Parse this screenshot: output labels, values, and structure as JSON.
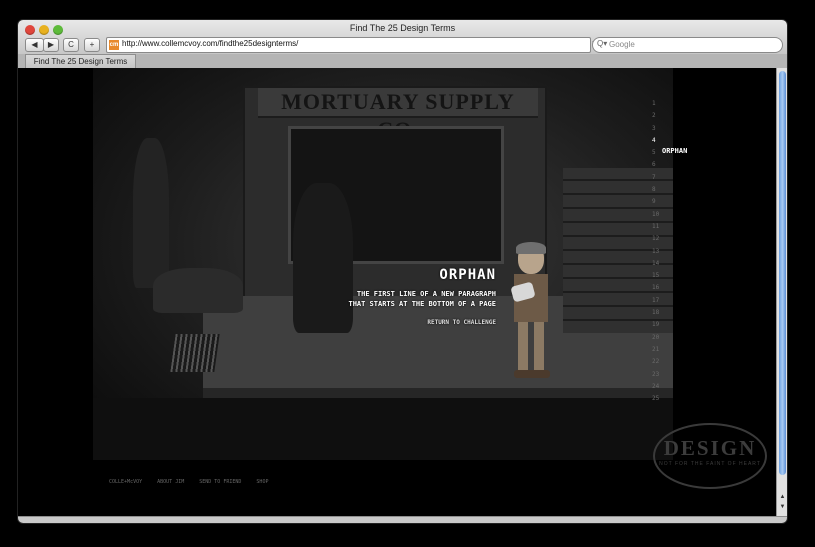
{
  "browser": {
    "window_title": "Find The 25 Design Terms",
    "url": "http://www.collemcvoy.com/findthe25designterms/",
    "search_placeholder": "Google",
    "tab_label": "Find The 25 Design Terms",
    "favicon": "cm"
  },
  "signboard_text": "MORTUARY SUPPLY CO.",
  "term": {
    "title": "ORPHAN",
    "definition_line1": "THE FIRST LINE OF A NEW PARAGRAPH",
    "definition_line2": "THAT STARTS AT THE BOTTOM OF A PAGE",
    "return_link": "RETURN TO CHALLENGE"
  },
  "term_nav": {
    "numbers": [
      "1",
      "2",
      "3",
      "4",
      "5",
      "6",
      "7",
      "8",
      "9",
      "10",
      "11",
      "12",
      "13",
      "14",
      "15",
      "16",
      "17",
      "18",
      "19",
      "20",
      "21",
      "22",
      "23",
      "24",
      "25"
    ],
    "active_index": 3,
    "active_label": "ORPHAN"
  },
  "footer_links": [
    "COLLE+McVOY",
    "ABOUT JIM",
    "SEND TO FRIEND",
    "SHOP"
  ],
  "logo": {
    "main": "DESIGN",
    "sub": "NOT FOR THE FAINT OF HEART"
  },
  "colors": {
    "background": "#000000",
    "scrollbar_thumb": "#6a9fe0"
  },
  "icons": {
    "back": "◀",
    "forward": "▶",
    "reload": "C",
    "add_bookmark": "+",
    "search": "Q▾",
    "dropdown": "▾",
    "scroll_up": "▲",
    "scroll_down": "▼"
  }
}
